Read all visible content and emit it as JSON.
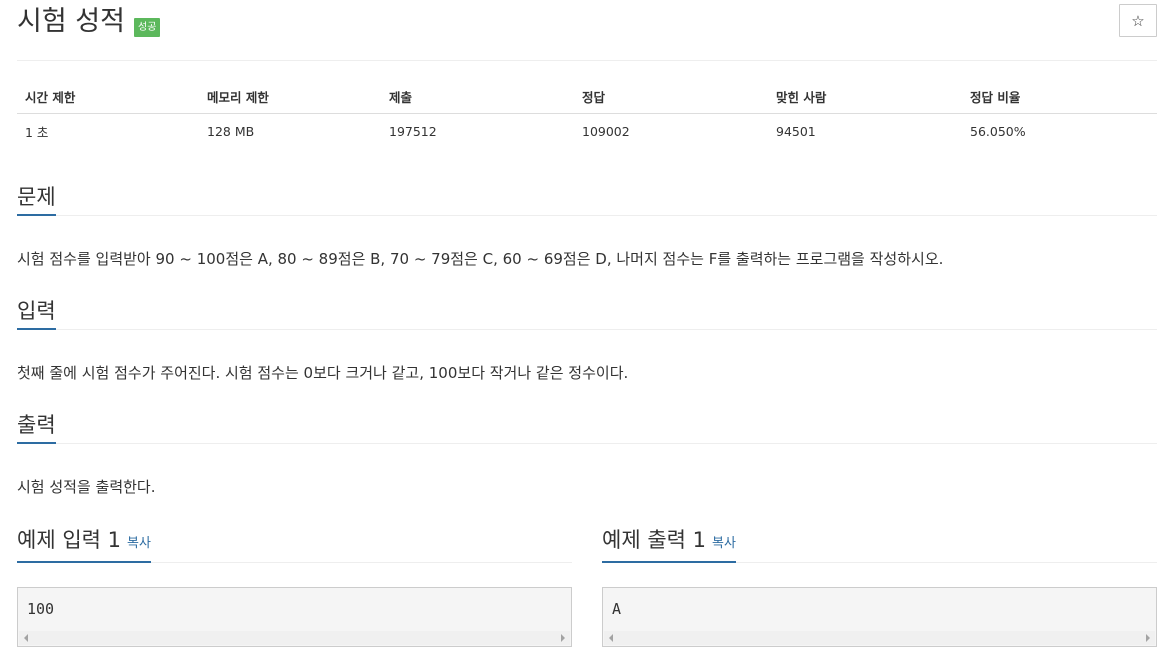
{
  "header": {
    "title": "시험 성적",
    "badge": "성공",
    "star_icon": "☆"
  },
  "info_table": {
    "headers": [
      "시간 제한",
      "메모리 제한",
      "제출",
      "정답",
      "맞힌 사람",
      "정답 비율"
    ],
    "values": [
      "1 초",
      "128 MB",
      "197512",
      "109002",
      "94501",
      "56.050%"
    ]
  },
  "sections": {
    "problem": {
      "title": "문제",
      "text": "시험 점수를 입력받아 90 ~ 100점은 A, 80 ~ 89점은 B, 70 ~ 79점은 C, 60 ~ 69점은 D, 나머지 점수는 F를 출력하는 프로그램을 작성하시오."
    },
    "input": {
      "title": "입력",
      "text": "첫째 줄에 시험 점수가 주어진다. 시험 점수는 0보다 크거나 같고, 100보다 작거나 같은 정수이다."
    },
    "output": {
      "title": "출력",
      "text": "시험 성적을 출력한다."
    }
  },
  "samples": {
    "input": {
      "title": "예제 입력 1",
      "copy_label": "복사",
      "content": "100"
    },
    "output": {
      "title": "예제 출력 1",
      "copy_label": "복사",
      "content": "A"
    }
  },
  "colors": {
    "accent": "#2d6ca2",
    "success": "#5cb85c"
  }
}
